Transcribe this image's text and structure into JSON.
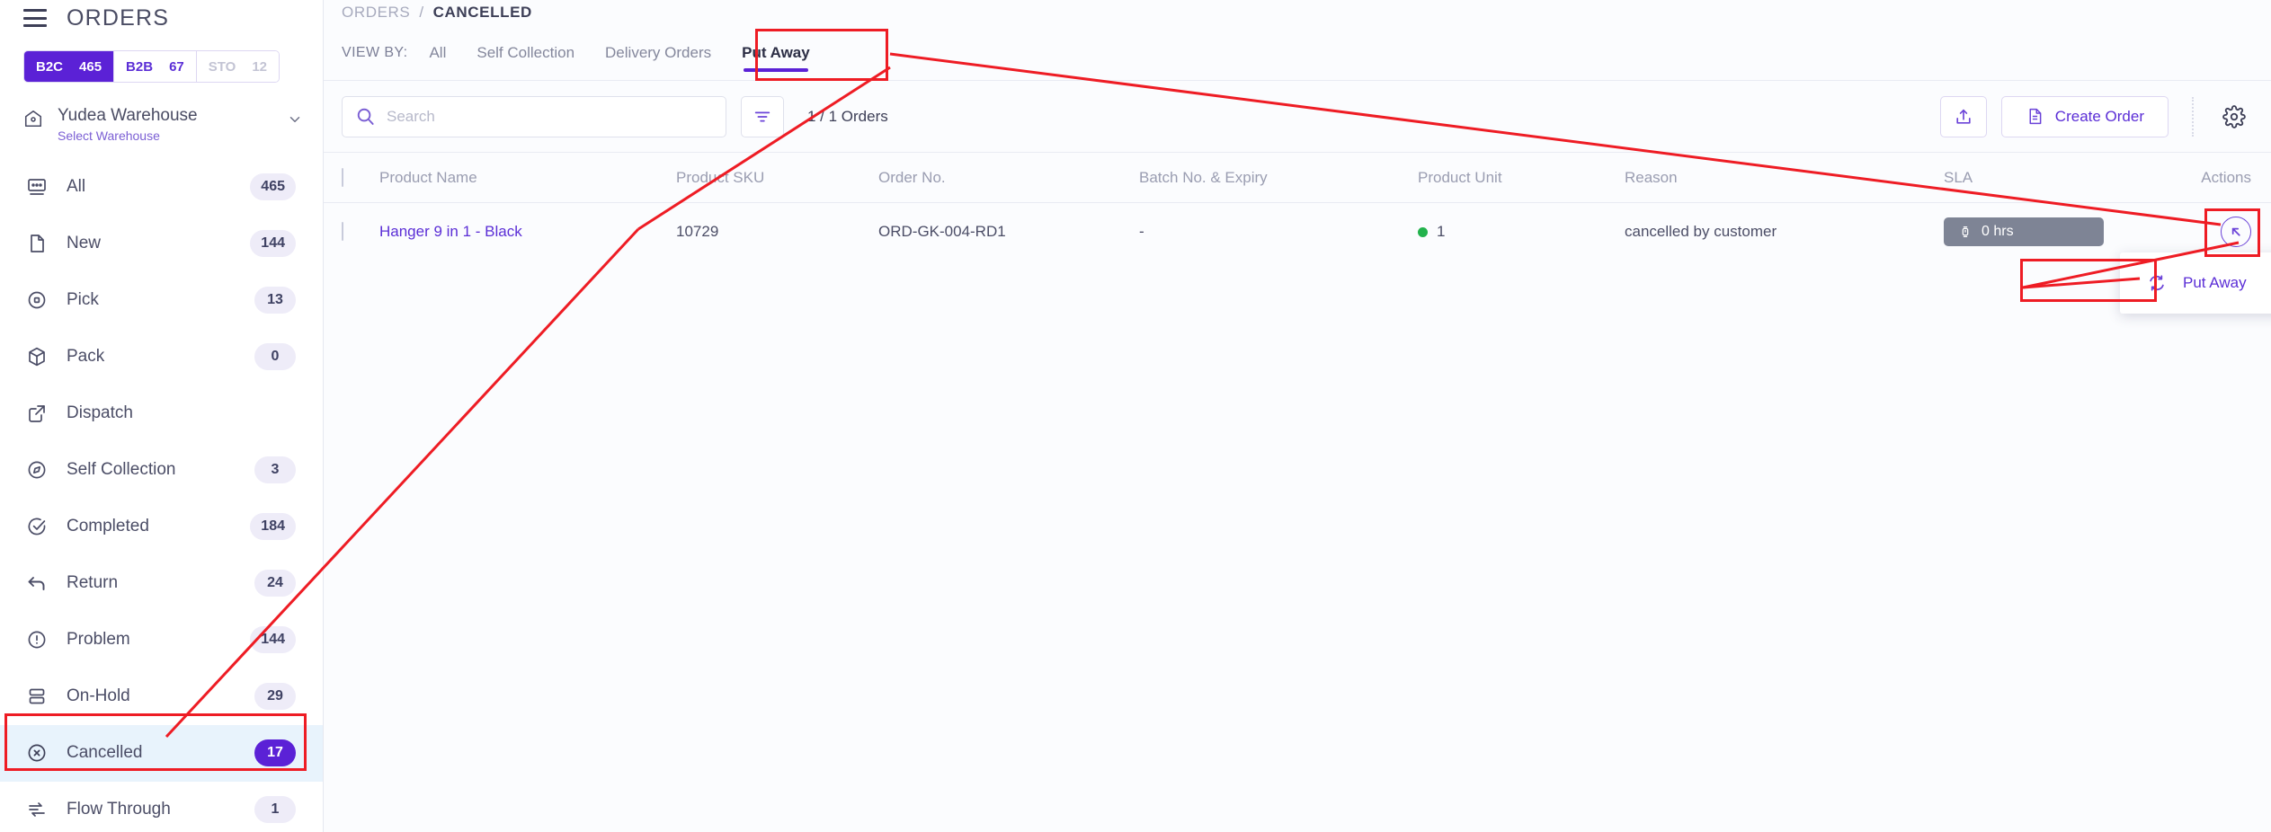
{
  "sidebar": {
    "menu_icon": "hamburger-icon",
    "title": "ORDERS",
    "segments": [
      {
        "label": "B2C",
        "count": "465",
        "state": "active"
      },
      {
        "label": "B2B",
        "count": "67",
        "state": "default"
      },
      {
        "label": "STO",
        "count": "12",
        "state": "disabled"
      }
    ],
    "warehouse": {
      "icon": "warehouse-icon",
      "name": "Yudea Warehouse",
      "subtitle": "Select Warehouse",
      "chevron": "chevron-down-icon"
    },
    "items": [
      {
        "icon": "all-orders-icon",
        "label": "All",
        "badge": "465",
        "selected": false
      },
      {
        "icon": "file-icon",
        "label": "New",
        "badge": "144",
        "selected": false
      },
      {
        "icon": "target-icon",
        "label": "Pick",
        "badge": "13",
        "selected": false
      },
      {
        "icon": "box-icon",
        "label": "Pack",
        "badge": "0",
        "selected": false
      },
      {
        "icon": "external-link-icon",
        "label": "Dispatch",
        "badge": "",
        "selected": false
      },
      {
        "icon": "compass-icon",
        "label": "Self Collection",
        "badge": "3",
        "selected": false
      },
      {
        "icon": "check-circle-icon",
        "label": "Completed",
        "badge": "184",
        "selected": false
      },
      {
        "icon": "return-arrow-icon",
        "label": "Return",
        "badge": "24",
        "selected": false
      },
      {
        "icon": "alert-circle-icon",
        "label": "Problem",
        "badge": "144",
        "selected": false
      },
      {
        "icon": "layers-icon",
        "label": "On-Hold",
        "badge": "29",
        "selected": false
      },
      {
        "icon": "cancel-circle-icon",
        "label": "Cancelled",
        "badge": "17",
        "selected": true
      },
      {
        "icon": "flow-through-icon",
        "label": "Flow Through",
        "badge": "1",
        "selected": false
      }
    ]
  },
  "breadcrumb": {
    "root": "ORDERS",
    "separator": "/",
    "current": "CANCELLED"
  },
  "viewbar": {
    "label": "VIEW BY:",
    "tabs": [
      {
        "label": "All",
        "active": false
      },
      {
        "label": "Self Collection",
        "active": false
      },
      {
        "label": "Delivery Orders",
        "active": false
      },
      {
        "label": "Put Away",
        "active": true
      }
    ]
  },
  "toolbar": {
    "search_placeholder": "Search",
    "search_value": "",
    "search_icon": "search-icon",
    "filter_icon": "filter-icon",
    "orders_count": "1 / 1 Orders",
    "upload_icon": "upload-icon",
    "create_order_label": "Create Order",
    "create_order_icon": "document-icon",
    "settings_icon": "gear-icon"
  },
  "table": {
    "columns": [
      "Product Name",
      "Product SKU",
      "Order No.",
      "Batch No. & Expiry",
      "Product Unit",
      "Reason",
      "SLA",
      "Actions"
    ],
    "rows": [
      {
        "product_name": "Hanger 9 in 1 - Black",
        "product_sku": "10729",
        "order_no": "ORD-GK-004-RD1",
        "batch_expiry": "-",
        "product_unit": "1",
        "reason": "cancelled by customer",
        "sla": "0 hrs",
        "sla_icon": "clock-icon",
        "action_icon": "put-away-arrow-icon"
      }
    ]
  },
  "action_menu": {
    "items": [
      {
        "icon": "refresh-icon",
        "label": "Put Away"
      }
    ]
  },
  "colors": {
    "accent": "#5b21d6",
    "accent_text": "#5b2ed6",
    "selected_row_bg": "#e8f3fc",
    "annotation": "#ee1c24",
    "sla_chip_bg": "#7e8495",
    "unit_dot": "#22b24c"
  }
}
